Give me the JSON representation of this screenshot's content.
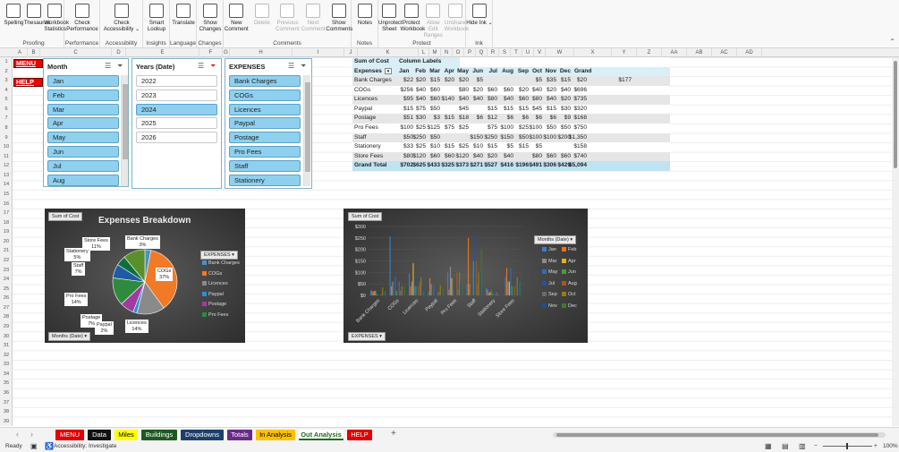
{
  "ribbon": {
    "groups": [
      {
        "label": "Proofing",
        "buttons": [
          "Spelling",
          "Thesaurus",
          "Workbook Statistics"
        ]
      },
      {
        "label": "Performance",
        "buttons": [
          "Check Performance"
        ]
      },
      {
        "label": "Accessibility",
        "buttons": [
          "Check Accessibility ⌄"
        ]
      },
      {
        "label": "Insights",
        "buttons": [
          "Smart Lookup"
        ]
      },
      {
        "label": "Language",
        "buttons": [
          "Translate"
        ]
      },
      {
        "label": "Changes",
        "buttons": [
          "Show Changes"
        ]
      },
      {
        "label": "Comments",
        "buttons": [
          "New Comment",
          "Delete",
          "Previous Comment",
          "Next Comment",
          "Show Comments"
        ]
      },
      {
        "label": "Notes",
        "buttons": [
          "Notes"
        ]
      },
      {
        "label": "Protect",
        "buttons": [
          "Unprotect Sheet",
          "Protect Workbook",
          "Allow Edit Ranges",
          "Unshare Workbook"
        ]
      },
      {
        "label": "Ink",
        "buttons": [
          "Hide Ink ⌄"
        ]
      }
    ]
  },
  "columns": [
    "A",
    "B",
    "C",
    "D",
    "E",
    "F",
    "G",
    "H",
    "I",
    "J",
    "K",
    "L",
    "M",
    "N",
    "O",
    "P",
    "Q",
    "R",
    "S",
    "T",
    "U",
    "V",
    "W",
    "X",
    "Y",
    "Z",
    "AA",
    "AB",
    "AC",
    "AD"
  ],
  "nav": {
    "menu": "MENU",
    "help": "HELP"
  },
  "slicers": {
    "month": {
      "title": "Month",
      "items": [
        "Jan",
        "Feb",
        "Mar",
        "Apr",
        "May",
        "Jun",
        "Jul",
        "Aug"
      ]
    },
    "years": {
      "title": "Years (Date)",
      "items": [
        "2022",
        "2023",
        "2024",
        "2025",
        "2026"
      ],
      "selected": "2024"
    },
    "expenses": {
      "title": "EXPENSES",
      "items": [
        "Bank Charges",
        "COGs",
        "Licences",
        "Paypal",
        "Postage",
        "Pro Fees",
        "Staff",
        "Stationery"
      ]
    }
  },
  "pivot": {
    "header1": "Sum of Cost",
    "header2": "Column Labels",
    "row_label": "Expenses",
    "months": [
      "Jan",
      "Feb",
      "Mar",
      "Apr",
      "May",
      "Jun",
      "Jul",
      "Aug",
      "Sep",
      "Oct",
      "Nov",
      "Dec",
      "Grand Total"
    ],
    "rows": [
      {
        "name": "Bank Charges",
        "vals": [
          "$22",
          "$20",
          "$15",
          "$20",
          "$20",
          "$5",
          "",
          "",
          "",
          "$5",
          "$35",
          "$15",
          "$20",
          "$177"
        ]
      },
      {
        "name": "COGs",
        "vals": [
          "$256",
          "$40",
          "$60",
          "",
          "$80",
          "$20",
          "$60",
          "$60",
          "$20",
          "$40",
          "$20",
          "$40",
          "$696"
        ]
      },
      {
        "name": "Licences",
        "vals": [
          "$95",
          "$40",
          "$60",
          "$140",
          "$40",
          "$40",
          "$80",
          "$40",
          "$60",
          "$80",
          "$40",
          "$20",
          "$735"
        ]
      },
      {
        "name": "Paypal",
        "vals": [
          "$15",
          "$75",
          "$50",
          "",
          "$45",
          "",
          "$15",
          "$15",
          "$15",
          "$45",
          "$15",
          "$30",
          "$320"
        ]
      },
      {
        "name": "Postage",
        "vals": [
          "$51",
          "$30",
          "$3",
          "$15",
          "$18",
          "$6",
          "$12",
          "$6",
          "$6",
          "$6",
          "$6",
          "$9",
          "$168"
        ]
      },
      {
        "name": "Pro Fees",
        "vals": [
          "$100",
          "$25",
          "$125",
          "$75",
          "$25",
          "",
          "$75",
          "$100",
          "$25",
          "$100",
          "$50",
          "$50",
          "$750"
        ]
      },
      {
        "name": "Staff",
        "vals": [
          "$50",
          "$250",
          "$50",
          "",
          "",
          "$150",
          "$250",
          "$150",
          "$50",
          "$100",
          "$100",
          "$200",
          "$1,350"
        ]
      },
      {
        "name": "Stationery",
        "vals": [
          "$33",
          "$25",
          "$10",
          "$15",
          "$25",
          "$10",
          "$15",
          "$5",
          "$15",
          "$5",
          "",
          "",
          "$158"
        ]
      },
      {
        "name": "Store Fees",
        "vals": [
          "$80",
          "$120",
          "$60",
          "$60",
          "$120",
          "$40",
          "$20",
          "$40",
          "",
          "$80",
          "$60",
          "$60",
          "$740"
        ]
      }
    ],
    "total": {
      "name": "Grand Total",
      "vals": [
        "$702",
        "$625",
        "$433",
        "$325",
        "$373",
        "$271",
        "$527",
        "$416",
        "$196",
        "$491",
        "$306",
        "$429",
        "$5,094"
      ]
    }
  },
  "chart_data": [
    {
      "type": "pie",
      "title": "Expenses Breakdown",
      "field_button": "Sum of Cost",
      "filter_button": "Months (Date)",
      "legend_title": "EXPENSES",
      "legend": [
        "Bank Charges",
        "COGs",
        "Licences",
        "Paypal",
        "Postage",
        "Pro Fees"
      ],
      "slices": [
        {
          "label": "Bank Charges",
          "pct": 3,
          "color": "#4a90c8"
        },
        {
          "label": "COGs",
          "pct": 37,
          "color": "#f07a26"
        },
        {
          "label": "Licences",
          "pct": 14,
          "color": "#8a8a8a"
        },
        {
          "label": "Paypal",
          "pct": 2,
          "color": "#2a8fd6"
        },
        {
          "label": "Postage",
          "pct": 7,
          "color": "#a23ba0"
        },
        {
          "label": "Pro Fees",
          "pct": 14,
          "color": "#2e8b3e"
        },
        {
          "label": "Staff",
          "pct": 7,
          "color": "#1f5aa6"
        },
        {
          "label": "Stationery",
          "pct": 5,
          "color": "#0e6e3a"
        },
        {
          "label": "Store Fees",
          "pct": 11,
          "color": "#5a8f2a"
        }
      ],
      "labels": [
        "Store Fees\n11%",
        "Bank Charges\n3%",
        "Stationery\n5%",
        "Staff\n7%",
        "COGs\n37%",
        "Pro Fees\n14%",
        "Postage\n7%",
        "Paypal\n2%",
        "Licences\n14%"
      ]
    },
    {
      "type": "bar",
      "field_button": "Sum of Cost",
      "filter_button": "EXPENSES",
      "legend_title": "Months (Date)",
      "categories": [
        "Bank Charges",
        "COGs",
        "Licences",
        "Paypal",
        "Pro Fees",
        "Staff",
        "Stationery",
        "Store Fees"
      ],
      "yticks": [
        "$300",
        "$250",
        "$200",
        "$150",
        "$100",
        "$50",
        "$0"
      ],
      "ylim": [
        0,
        300
      ],
      "legend": [
        "Jan",
        "Feb",
        "Mar",
        "Apr",
        "May",
        "Jun",
        "Jul",
        "Aug",
        "Sep",
        "Oct",
        "Nov",
        "Dec"
      ],
      "colors": [
        "#3a7fc2",
        "#e8731e",
        "#8b8b8b",
        "#e3b21c",
        "#2d6fb5",
        "#4f9a3a",
        "#2552a0",
        "#a05a1e",
        "#6a6a6a",
        "#9a7a10",
        "#1f4f8f",
        "#3f7a2a"
      ],
      "series": [
        [
          22,
          20,
          15,
          20,
          20,
          5,
          0,
          0,
          5,
          35,
          15,
          20
        ],
        [
          256,
          40,
          60,
          0,
          80,
          20,
          60,
          60,
          20,
          40,
          20,
          40
        ],
        [
          95,
          40,
          60,
          140,
          40,
          40,
          80,
          40,
          60,
          80,
          40,
          20
        ],
        [
          15,
          75,
          50,
          0,
          45,
          0,
          15,
          15,
          15,
          45,
          15,
          30
        ],
        [
          100,
          25,
          125,
          75,
          25,
          0,
          75,
          100,
          25,
          100,
          50,
          50
        ],
        [
          50,
          250,
          50,
          0,
          0,
          150,
          250,
          150,
          50,
          100,
          100,
          200
        ],
        [
          33,
          25,
          10,
          15,
          25,
          10,
          15,
          5,
          15,
          5,
          0,
          0
        ],
        [
          80,
          120,
          60,
          60,
          120,
          40,
          20,
          40,
          0,
          80,
          60,
          60
        ]
      ]
    }
  ],
  "tabs": [
    {
      "name": "MENU",
      "bg": "#e00000",
      "fg": "#fff"
    },
    {
      "name": "Data",
      "bg": "#111",
      "fg": "#fff"
    },
    {
      "name": "Miles",
      "bg": "#ffff00",
      "fg": "#000"
    },
    {
      "name": "Buildings",
      "bg": "#1e5a20",
      "fg": "#fff"
    },
    {
      "name": "Dropdowns",
      "bg": "#1f3f6b",
      "fg": "#fff"
    },
    {
      "name": "Totals",
      "bg": "#6a2a8a",
      "fg": "#fff"
    },
    {
      "name": "In Analysis",
      "bg": "#ffc000",
      "fg": "#000"
    },
    {
      "name": "Out Analysis",
      "bg": "#ffffff",
      "fg": "#1e6a1e",
      "active": true
    },
    {
      "name": "HELP",
      "bg": "#e00000",
      "fg": "#fff"
    }
  ],
  "status": {
    "ready": "Ready",
    "accessibility": "Accessibility: Investigate",
    "zoom": "100%"
  }
}
